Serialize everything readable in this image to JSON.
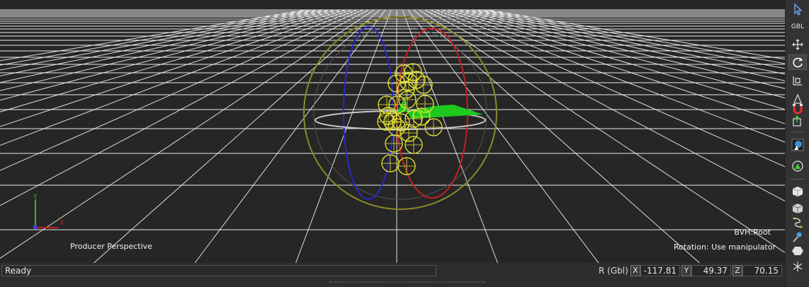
{
  "viewport": {
    "camera_label": "Producer Perspective",
    "selection_label": "BVH:Root",
    "mode_label": "Rotation: Use manipulator",
    "axis_gizmo": {
      "y_label": "Y",
      "x_label": "X"
    }
  },
  "toolbar": {
    "space_label": "GBL",
    "tools": [
      "select-arrow-icon",
      "global-space-label",
      "translate-icon",
      "rotate-icon",
      "scale-icon",
      "trim-icon",
      "magnet-icon",
      "pivot-icon",
      "look-through-icon",
      "isolate-icon",
      "cube-solid-icon",
      "cube-wire-icon",
      "path-icon",
      "pin-icon",
      "hexagon-icon",
      "asterisk-icon"
    ]
  },
  "status": {
    "message": "Ready",
    "rotation_mode": "R (Gbl)",
    "x_label": "X",
    "x_value": "-117.81",
    "y_label": "Y",
    "y_value": "49.37",
    "z_label": "Z",
    "z_value": "70.15"
  },
  "colors": {
    "background": "#262626",
    "grid": "#ffffff",
    "skeleton": "#e6e632",
    "manipulator_red": "#c81e1e",
    "manipulator_blue": "#2828c8",
    "manipulator_green": "#1ec81e"
  }
}
